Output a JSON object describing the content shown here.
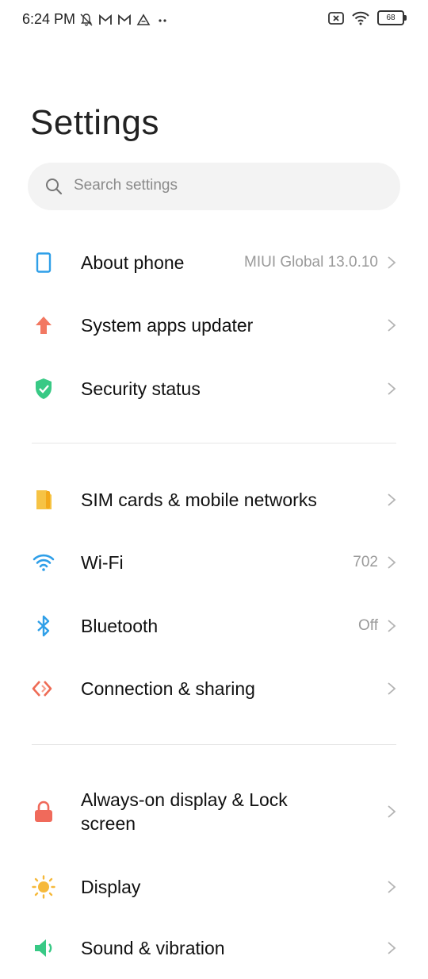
{
  "status_bar": {
    "time": "6:24 PM",
    "left_icons": [
      "mute-icon",
      "gmail-icon",
      "gmail-icon",
      "drive-icon",
      "more-dots-icon"
    ],
    "battery_level": "68"
  },
  "page": {
    "title": "Settings",
    "search_placeholder": "Search settings"
  },
  "groups": [
    [
      {
        "label": "About phone",
        "value": "MIUI Global 13.0.10",
        "icon": "phone-outline-icon",
        "color": "#2f9fe8"
      },
      {
        "label": "System apps updater",
        "value": "",
        "icon": "arrow-up-icon",
        "color": "#f27862"
      },
      {
        "label": "Security status",
        "value": "",
        "icon": "shield-check-icon",
        "color": "#38c985"
      }
    ],
    [
      {
        "label": "SIM cards & mobile networks",
        "value": "",
        "icon": "sim-card-icon",
        "color": "#f6c344"
      },
      {
        "label": "Wi-Fi",
        "value": "702",
        "icon": "wifi-icon",
        "color": "#2f9fe8"
      },
      {
        "label": "Bluetooth",
        "value": "Off",
        "icon": "bluetooth-icon",
        "color": "#2f9fe8"
      },
      {
        "label": "Connection & sharing",
        "value": "",
        "icon": "connection-sharing-icon",
        "color": "#ee6b55"
      }
    ],
    [
      {
        "label": "Always-on display & Lock\nscreen",
        "value": "",
        "icon": "lock-icon",
        "color": "#f06a5b"
      },
      {
        "label": "Display",
        "value": "",
        "icon": "sun-icon",
        "color": "#f6b93b"
      },
      {
        "label": "Sound & vibration",
        "value": "",
        "icon": "speaker-icon",
        "color": "#38c985"
      }
    ]
  ]
}
